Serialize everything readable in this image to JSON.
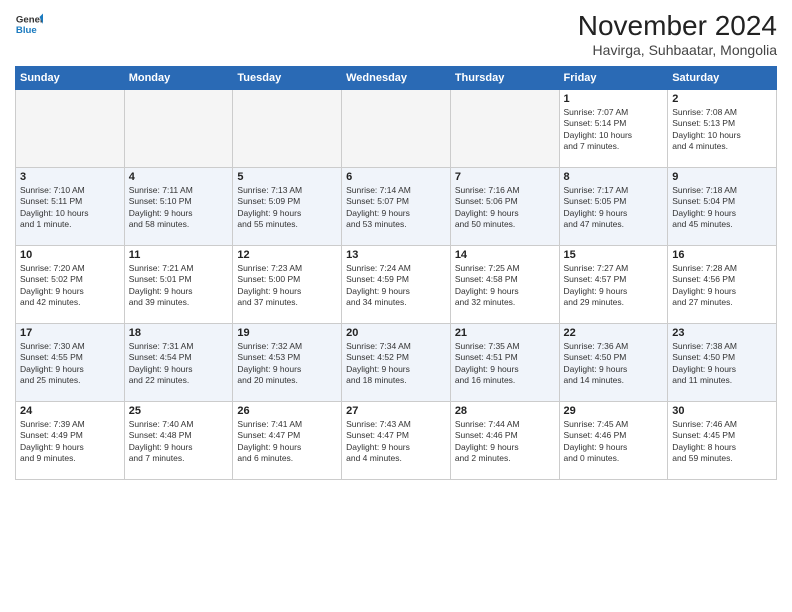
{
  "header": {
    "logo_line1": "General",
    "logo_line2": "Blue",
    "title": "November 2024",
    "subtitle": "Havirga, Suhbaatar, Mongolia"
  },
  "weekdays": [
    "Sunday",
    "Monday",
    "Tuesday",
    "Wednesday",
    "Thursday",
    "Friday",
    "Saturday"
  ],
  "weeks": [
    [
      {
        "day": "",
        "info": "",
        "empty": true
      },
      {
        "day": "",
        "info": "",
        "empty": true
      },
      {
        "day": "",
        "info": "",
        "empty": true
      },
      {
        "day": "",
        "info": "",
        "empty": true
      },
      {
        "day": "",
        "info": "",
        "empty": true
      },
      {
        "day": "1",
        "info": "Sunrise: 7:07 AM\nSunset: 5:14 PM\nDaylight: 10 hours\nand 7 minutes."
      },
      {
        "day": "2",
        "info": "Sunrise: 7:08 AM\nSunset: 5:13 PM\nDaylight: 10 hours\nand 4 minutes."
      }
    ],
    [
      {
        "day": "3",
        "info": "Sunrise: 7:10 AM\nSunset: 5:11 PM\nDaylight: 10 hours\nand 1 minute."
      },
      {
        "day": "4",
        "info": "Sunrise: 7:11 AM\nSunset: 5:10 PM\nDaylight: 9 hours\nand 58 minutes."
      },
      {
        "day": "5",
        "info": "Sunrise: 7:13 AM\nSunset: 5:09 PM\nDaylight: 9 hours\nand 55 minutes."
      },
      {
        "day": "6",
        "info": "Sunrise: 7:14 AM\nSunset: 5:07 PM\nDaylight: 9 hours\nand 53 minutes."
      },
      {
        "day": "7",
        "info": "Sunrise: 7:16 AM\nSunset: 5:06 PM\nDaylight: 9 hours\nand 50 minutes."
      },
      {
        "day": "8",
        "info": "Sunrise: 7:17 AM\nSunset: 5:05 PM\nDaylight: 9 hours\nand 47 minutes."
      },
      {
        "day": "9",
        "info": "Sunrise: 7:18 AM\nSunset: 5:04 PM\nDaylight: 9 hours\nand 45 minutes."
      }
    ],
    [
      {
        "day": "10",
        "info": "Sunrise: 7:20 AM\nSunset: 5:02 PM\nDaylight: 9 hours\nand 42 minutes."
      },
      {
        "day": "11",
        "info": "Sunrise: 7:21 AM\nSunset: 5:01 PM\nDaylight: 9 hours\nand 39 minutes."
      },
      {
        "day": "12",
        "info": "Sunrise: 7:23 AM\nSunset: 5:00 PM\nDaylight: 9 hours\nand 37 minutes."
      },
      {
        "day": "13",
        "info": "Sunrise: 7:24 AM\nSunset: 4:59 PM\nDaylight: 9 hours\nand 34 minutes."
      },
      {
        "day": "14",
        "info": "Sunrise: 7:25 AM\nSunset: 4:58 PM\nDaylight: 9 hours\nand 32 minutes."
      },
      {
        "day": "15",
        "info": "Sunrise: 7:27 AM\nSunset: 4:57 PM\nDaylight: 9 hours\nand 29 minutes."
      },
      {
        "day": "16",
        "info": "Sunrise: 7:28 AM\nSunset: 4:56 PM\nDaylight: 9 hours\nand 27 minutes."
      }
    ],
    [
      {
        "day": "17",
        "info": "Sunrise: 7:30 AM\nSunset: 4:55 PM\nDaylight: 9 hours\nand 25 minutes."
      },
      {
        "day": "18",
        "info": "Sunrise: 7:31 AM\nSunset: 4:54 PM\nDaylight: 9 hours\nand 22 minutes."
      },
      {
        "day": "19",
        "info": "Sunrise: 7:32 AM\nSunset: 4:53 PM\nDaylight: 9 hours\nand 20 minutes."
      },
      {
        "day": "20",
        "info": "Sunrise: 7:34 AM\nSunset: 4:52 PM\nDaylight: 9 hours\nand 18 minutes."
      },
      {
        "day": "21",
        "info": "Sunrise: 7:35 AM\nSunset: 4:51 PM\nDaylight: 9 hours\nand 16 minutes."
      },
      {
        "day": "22",
        "info": "Sunrise: 7:36 AM\nSunset: 4:50 PM\nDaylight: 9 hours\nand 14 minutes."
      },
      {
        "day": "23",
        "info": "Sunrise: 7:38 AM\nSunset: 4:50 PM\nDaylight: 9 hours\nand 11 minutes."
      }
    ],
    [
      {
        "day": "24",
        "info": "Sunrise: 7:39 AM\nSunset: 4:49 PM\nDaylight: 9 hours\nand 9 minutes."
      },
      {
        "day": "25",
        "info": "Sunrise: 7:40 AM\nSunset: 4:48 PM\nDaylight: 9 hours\nand 7 minutes."
      },
      {
        "day": "26",
        "info": "Sunrise: 7:41 AM\nSunset: 4:47 PM\nDaylight: 9 hours\nand 6 minutes."
      },
      {
        "day": "27",
        "info": "Sunrise: 7:43 AM\nSunset: 4:47 PM\nDaylight: 9 hours\nand 4 minutes."
      },
      {
        "day": "28",
        "info": "Sunrise: 7:44 AM\nSunset: 4:46 PM\nDaylight: 9 hours\nand 2 minutes."
      },
      {
        "day": "29",
        "info": "Sunrise: 7:45 AM\nSunset: 4:46 PM\nDaylight: 9 hours\nand 0 minutes."
      },
      {
        "day": "30",
        "info": "Sunrise: 7:46 AM\nSunset: 4:45 PM\nDaylight: 8 hours\nand 59 minutes."
      }
    ]
  ]
}
